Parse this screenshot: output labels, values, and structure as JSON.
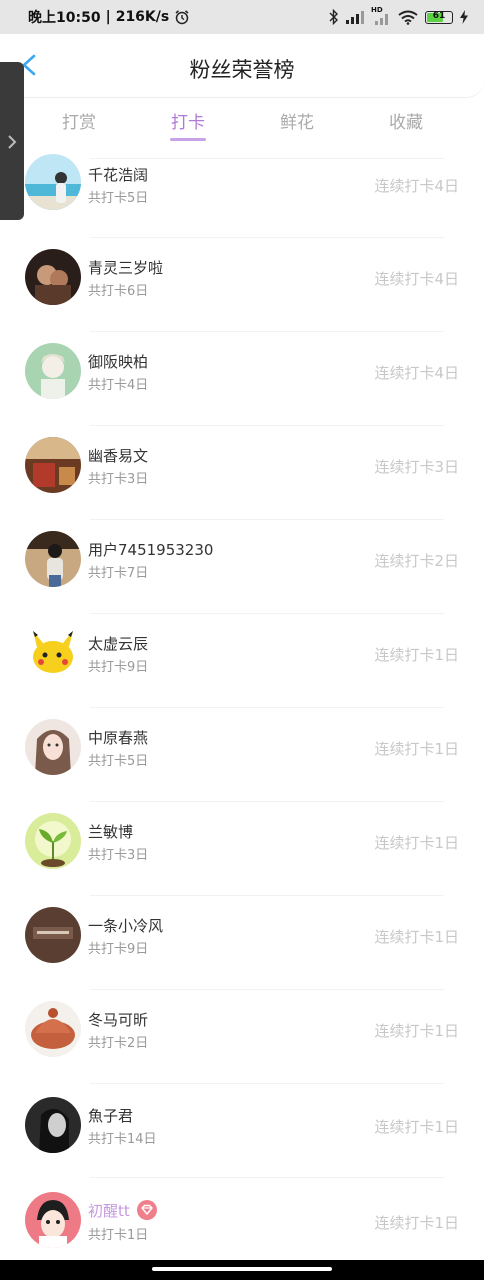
{
  "status_bar": {
    "time": "晚上10:50",
    "speed": "216K/s",
    "battery_level": "61",
    "hd_label": "HD"
  },
  "header": {
    "title": "粉丝荣誉榜"
  },
  "tabs": [
    {
      "label": "打赏",
      "active": false
    },
    {
      "label": "打卡",
      "active": true
    },
    {
      "label": "鲜花",
      "active": false
    },
    {
      "label": "收藏",
      "active": false
    }
  ],
  "colors": {
    "accent": "#b07ad6",
    "underline": "#c7a3e6",
    "muted": "#999999",
    "streak": "#c8c8c8"
  },
  "fans": [
    {
      "name": "千花浩阔",
      "total": "共打卡5日",
      "streak": "连续打卡4日",
      "avatar": "beach-photo"
    },
    {
      "name": "青灵三岁啦",
      "total": "共打卡6日",
      "streak": "连续打卡4日",
      "avatar": "couple-photo"
    },
    {
      "name": "御阪映柏",
      "total": "共打卡4日",
      "streak": "连续打卡4日",
      "avatar": "anime-boy"
    },
    {
      "name": "幽香易文",
      "total": "共打卡3日",
      "streak": "连续打卡3日",
      "avatar": "autumn-photo"
    },
    {
      "name": "用户7451953230",
      "total": "共打卡7日",
      "streak": "连续打卡2日",
      "avatar": "girl-photo"
    },
    {
      "name": "太虚云辰",
      "total": "共打卡9日",
      "streak": "连续打卡1日",
      "avatar": "pikachu"
    },
    {
      "name": "中原春燕",
      "total": "共打卡5日",
      "streak": "连续打卡1日",
      "avatar": "woman-portrait"
    },
    {
      "name": "兰敏博",
      "total": "共打卡3日",
      "streak": "连续打卡1日",
      "avatar": "sprout"
    },
    {
      "name": "一条小冷风",
      "total": "共打卡9日",
      "streak": "连续打卡1日",
      "avatar": "text-logo"
    },
    {
      "name": "冬马可昕",
      "total": "共打卡2日",
      "streak": "连续打卡1日",
      "avatar": "knit-hat"
    },
    {
      "name": "魚子君",
      "total": "共打卡14日",
      "streak": "连续打卡1日",
      "avatar": "dark-portrait"
    },
    {
      "name": "初醒tt",
      "total": "共打卡1日",
      "streak": "连续打卡1日",
      "avatar": "cartoon-boy",
      "highlight": true,
      "badge": "vip-diamond-icon"
    }
  ]
}
